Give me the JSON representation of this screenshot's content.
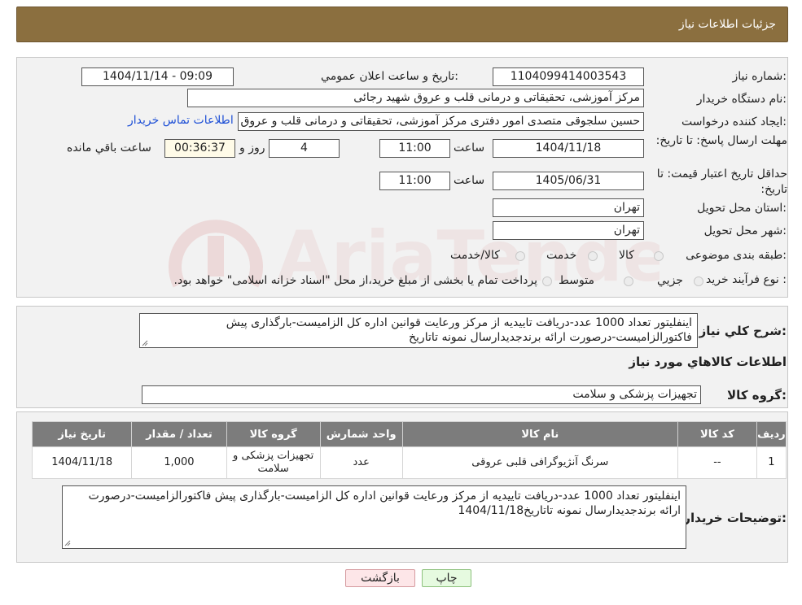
{
  "header": {
    "title": "جزئیات اطلاعات نیاز"
  },
  "form": {
    "need_number_label": "شماره نیاز:",
    "need_number": "1104099414003543",
    "announce_label": "تاریخ و ساعت اعلان عمومي:",
    "announce_value": "1404/11/14 - 09:09",
    "buyer_org_label": "نام دستگاه خریدار:",
    "buyer_org": "مرکز آموزشی، تحقیقاتی و درمانی قلب و عروق شهید رجائی",
    "requester_label": "ایجاد کننده درخواست:",
    "requester": "حسین سلجوقی متصدی امور دفتری مرکز آموزشی، تحقیقاتی و درمانی قلب و عروق شهید رجائی",
    "contact_link": "اطلاعات تماس خریدار",
    "deadline_label": "مهلت ارسال پاسخ: تا تاریخ:",
    "deadline_date": "1404/11/18",
    "time_label": "ساعت",
    "deadline_time": "11:00",
    "days_value": "4",
    "days_label": "روز و",
    "remaining_time": "00:36:37",
    "remaining_label": "ساعت باقي مانده",
    "validity_label": "حداقل تاریخ اعتبار قیمت: تا تاریخ:",
    "validity_date": "1405/06/31",
    "validity_time_label": "ساعت",
    "validity_time": "11:00",
    "province_label": "استان محل تحویل:",
    "province": "تهران",
    "city_label": "شهر محل تحویل:",
    "city": "تهران",
    "category_label": "طبقه بندی موضوعی:",
    "category_options": [
      "کالا",
      "خدمت",
      "کالا/خدمت"
    ],
    "process_label": "نوع فرآیند خرید :",
    "process_options": [
      "جزیي",
      "متوسط"
    ],
    "process_note": "پرداخت تمام یا بخشی از مبلغ خرید،از محل \"اسناد خزانه اسلامی\" خواهد بود."
  },
  "description": {
    "label": "شرح کلي نیاز:",
    "text": "اینفلیتور تعداد 1000 عدد-دریافت تاییدیه از مرکز ورعایت قوانین اداره کل الزامیست-بارگذاری پیش فاکتورالزامیست-درصورت ارائه برندجدیدارسال نمونه تاتاریخ"
  },
  "goods_info": {
    "title": "اطلاعات کالاهاي مورد نیاز",
    "group_label": "گروه کالا:",
    "group_value": "تجهیزات پزشکی و سلامت"
  },
  "table": {
    "headers": [
      "ردیف",
      "کد کالا",
      "نام کالا",
      "واحد شمارش",
      "گروه کالا",
      "تعداد / مقدار",
      "تاریخ نیاز"
    ],
    "rows": [
      {
        "row": "1",
        "code": "--",
        "name": "سرنگ آنژیوگرافی قلبی عروقی",
        "unit": "عدد",
        "group": "تجهیزات پزشکی و سلامت",
        "qty": "1,000",
        "date": "1404/11/18"
      }
    ]
  },
  "buyer_notes": {
    "label": "توضیحات خریدار:",
    "text": "اینفلیتور تعداد 1000 عدد-دریافت تاییدیه از مرکز ورعایت قوانین اداره کل الزامیست-بارگذاری پیش فاکتورالزامیست-درصورت ارائه برندجدیدارسال نمونه تاتاریخ1404/11/18"
  },
  "buttons": {
    "print": "چاپ",
    "back": "بازگشت"
  },
  "watermark": {
    "text": "AriaTender.neT"
  },
  "colors": {
    "header_bg": "#8b6f3f",
    "link": "#1d4fd6",
    "table_header": "#7c7c7c"
  }
}
